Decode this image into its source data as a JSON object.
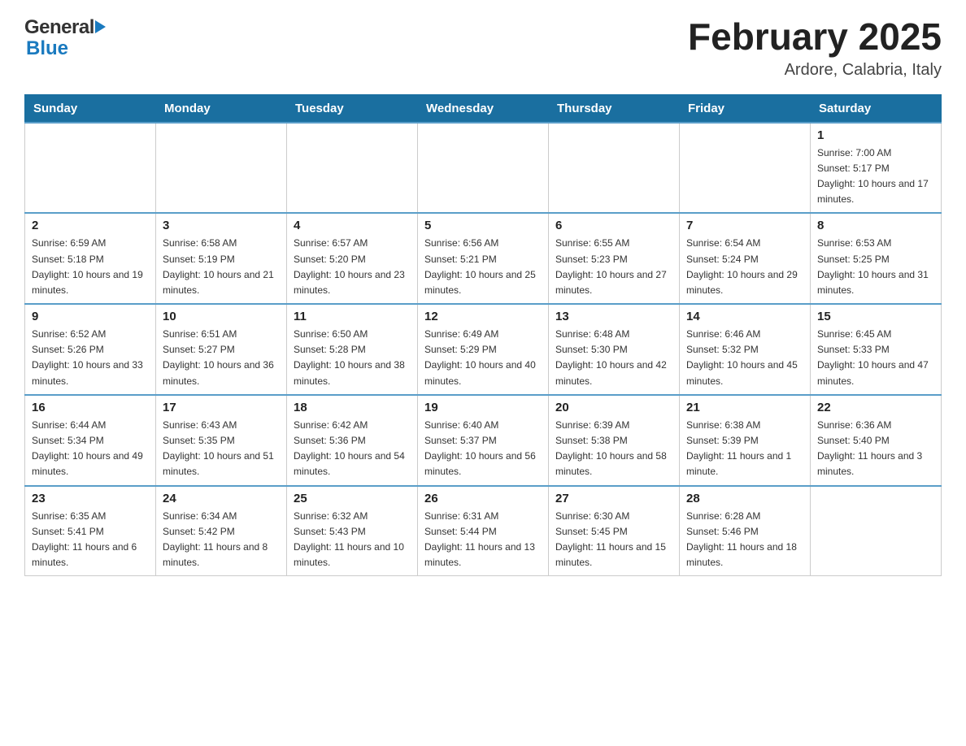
{
  "header": {
    "logo_general": "General",
    "logo_blue": "Blue",
    "month_year": "February 2025",
    "location": "Ardore, Calabria, Italy"
  },
  "weekdays": [
    "Sunday",
    "Monday",
    "Tuesday",
    "Wednesday",
    "Thursday",
    "Friday",
    "Saturday"
  ],
  "weeks": [
    [
      {
        "day": "",
        "info": ""
      },
      {
        "day": "",
        "info": ""
      },
      {
        "day": "",
        "info": ""
      },
      {
        "day": "",
        "info": ""
      },
      {
        "day": "",
        "info": ""
      },
      {
        "day": "",
        "info": ""
      },
      {
        "day": "1",
        "info": "Sunrise: 7:00 AM\nSunset: 5:17 PM\nDaylight: 10 hours and 17 minutes."
      }
    ],
    [
      {
        "day": "2",
        "info": "Sunrise: 6:59 AM\nSunset: 5:18 PM\nDaylight: 10 hours and 19 minutes."
      },
      {
        "day": "3",
        "info": "Sunrise: 6:58 AM\nSunset: 5:19 PM\nDaylight: 10 hours and 21 minutes."
      },
      {
        "day": "4",
        "info": "Sunrise: 6:57 AM\nSunset: 5:20 PM\nDaylight: 10 hours and 23 minutes."
      },
      {
        "day": "5",
        "info": "Sunrise: 6:56 AM\nSunset: 5:21 PM\nDaylight: 10 hours and 25 minutes."
      },
      {
        "day": "6",
        "info": "Sunrise: 6:55 AM\nSunset: 5:23 PM\nDaylight: 10 hours and 27 minutes."
      },
      {
        "day": "7",
        "info": "Sunrise: 6:54 AM\nSunset: 5:24 PM\nDaylight: 10 hours and 29 minutes."
      },
      {
        "day": "8",
        "info": "Sunrise: 6:53 AM\nSunset: 5:25 PM\nDaylight: 10 hours and 31 minutes."
      }
    ],
    [
      {
        "day": "9",
        "info": "Sunrise: 6:52 AM\nSunset: 5:26 PM\nDaylight: 10 hours and 33 minutes."
      },
      {
        "day": "10",
        "info": "Sunrise: 6:51 AM\nSunset: 5:27 PM\nDaylight: 10 hours and 36 minutes."
      },
      {
        "day": "11",
        "info": "Sunrise: 6:50 AM\nSunset: 5:28 PM\nDaylight: 10 hours and 38 minutes."
      },
      {
        "day": "12",
        "info": "Sunrise: 6:49 AM\nSunset: 5:29 PM\nDaylight: 10 hours and 40 minutes."
      },
      {
        "day": "13",
        "info": "Sunrise: 6:48 AM\nSunset: 5:30 PM\nDaylight: 10 hours and 42 minutes."
      },
      {
        "day": "14",
        "info": "Sunrise: 6:46 AM\nSunset: 5:32 PM\nDaylight: 10 hours and 45 minutes."
      },
      {
        "day": "15",
        "info": "Sunrise: 6:45 AM\nSunset: 5:33 PM\nDaylight: 10 hours and 47 minutes."
      }
    ],
    [
      {
        "day": "16",
        "info": "Sunrise: 6:44 AM\nSunset: 5:34 PM\nDaylight: 10 hours and 49 minutes."
      },
      {
        "day": "17",
        "info": "Sunrise: 6:43 AM\nSunset: 5:35 PM\nDaylight: 10 hours and 51 minutes."
      },
      {
        "day": "18",
        "info": "Sunrise: 6:42 AM\nSunset: 5:36 PM\nDaylight: 10 hours and 54 minutes."
      },
      {
        "day": "19",
        "info": "Sunrise: 6:40 AM\nSunset: 5:37 PM\nDaylight: 10 hours and 56 minutes."
      },
      {
        "day": "20",
        "info": "Sunrise: 6:39 AM\nSunset: 5:38 PM\nDaylight: 10 hours and 58 minutes."
      },
      {
        "day": "21",
        "info": "Sunrise: 6:38 AM\nSunset: 5:39 PM\nDaylight: 11 hours and 1 minute."
      },
      {
        "day": "22",
        "info": "Sunrise: 6:36 AM\nSunset: 5:40 PM\nDaylight: 11 hours and 3 minutes."
      }
    ],
    [
      {
        "day": "23",
        "info": "Sunrise: 6:35 AM\nSunset: 5:41 PM\nDaylight: 11 hours and 6 minutes."
      },
      {
        "day": "24",
        "info": "Sunrise: 6:34 AM\nSunset: 5:42 PM\nDaylight: 11 hours and 8 minutes."
      },
      {
        "day": "25",
        "info": "Sunrise: 6:32 AM\nSunset: 5:43 PM\nDaylight: 11 hours and 10 minutes."
      },
      {
        "day": "26",
        "info": "Sunrise: 6:31 AM\nSunset: 5:44 PM\nDaylight: 11 hours and 13 minutes."
      },
      {
        "day": "27",
        "info": "Sunrise: 6:30 AM\nSunset: 5:45 PM\nDaylight: 11 hours and 15 minutes."
      },
      {
        "day": "28",
        "info": "Sunrise: 6:28 AM\nSunset: 5:46 PM\nDaylight: 11 hours and 18 minutes."
      },
      {
        "day": "",
        "info": ""
      }
    ]
  ]
}
